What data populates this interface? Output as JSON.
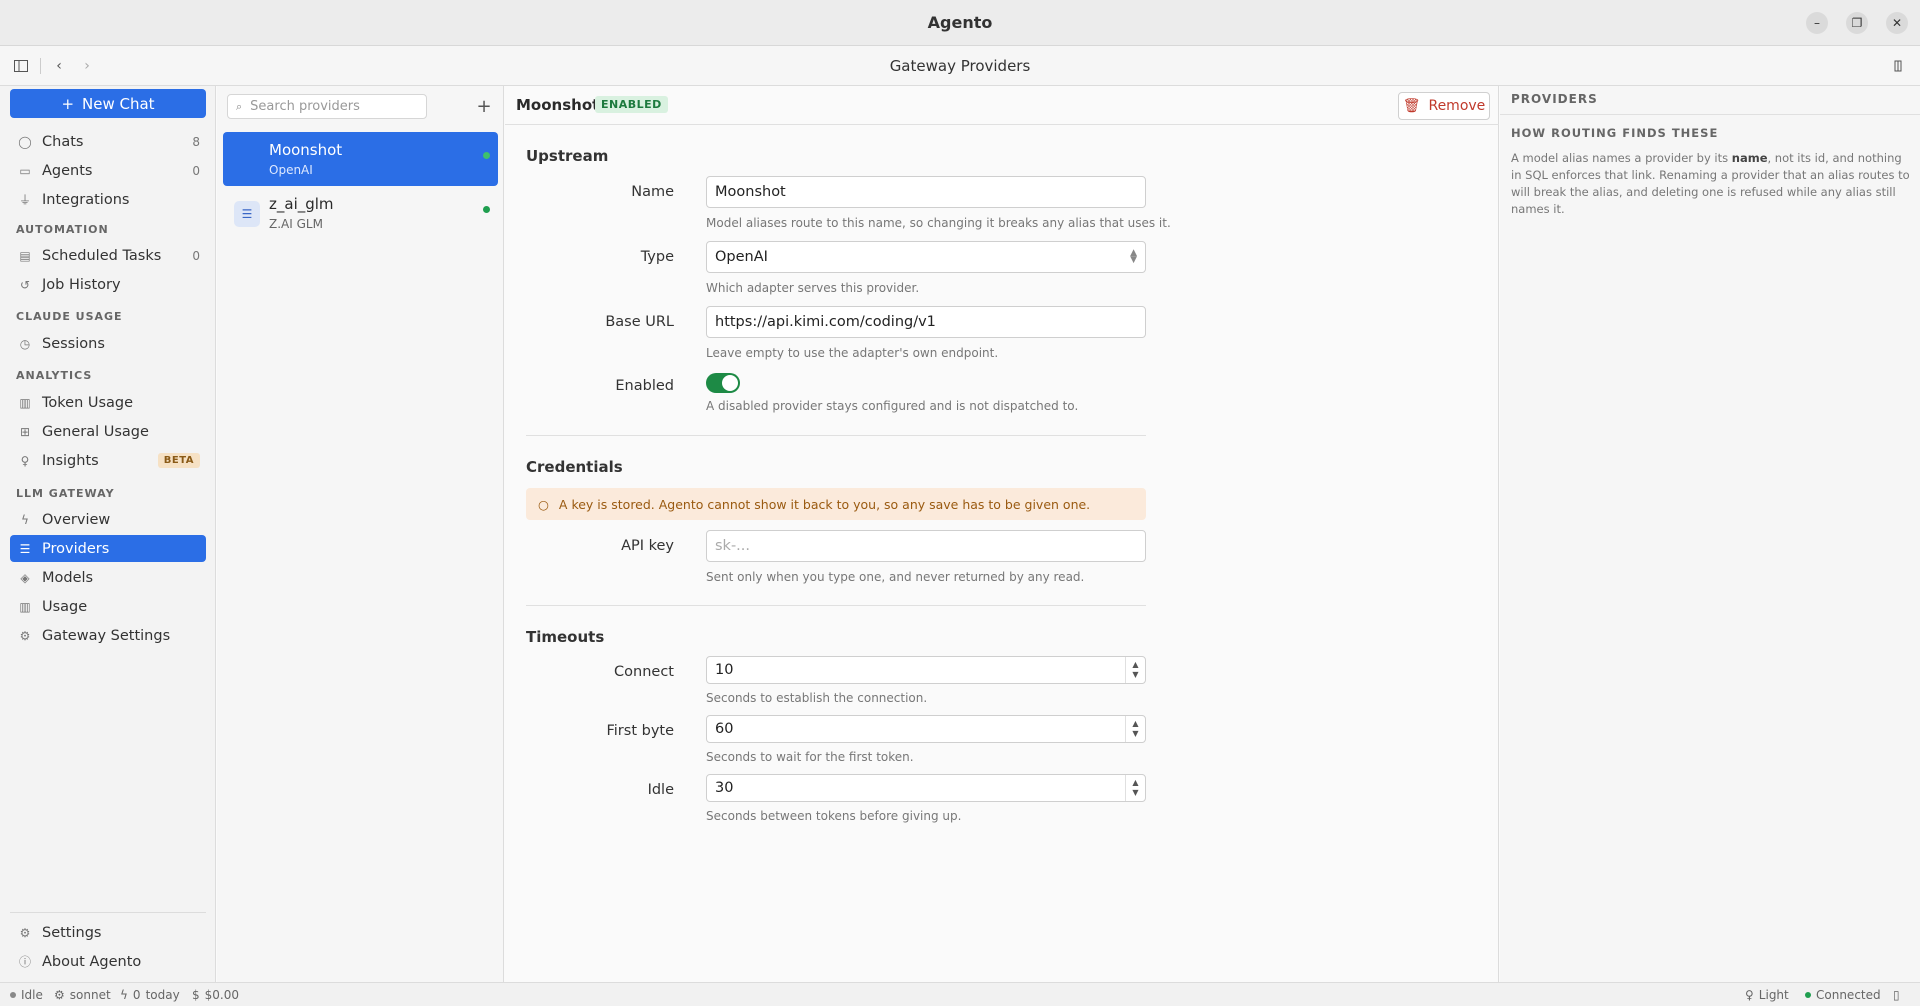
{
  "window": {
    "title": "Agento"
  },
  "toolbar": {
    "page_title": "Gateway Providers"
  },
  "sidebar": {
    "new_chat": "New Chat",
    "items": [
      {
        "label": "Chats",
        "count": "8",
        "icon": "chat-icon"
      },
      {
        "label": "Agents",
        "count": "0",
        "icon": "agents-icon"
      },
      {
        "label": "Integrations",
        "icon": "plug-icon"
      }
    ],
    "automation": {
      "heading": "AUTOMATION",
      "items": [
        {
          "label": "Scheduled Tasks",
          "count": "0",
          "icon": "calendar-icon"
        },
        {
          "label": "Job History",
          "icon": "history-icon"
        }
      ]
    },
    "claude_usage": {
      "heading": "CLAUDE USAGE",
      "items": [
        {
          "label": "Sessions",
          "icon": "clock-icon"
        }
      ]
    },
    "analytics": {
      "heading": "ANALYTICS",
      "items": [
        {
          "label": "Token Usage",
          "icon": "bar-chart-icon"
        },
        {
          "label": "General Usage",
          "icon": "grid-icon"
        },
        {
          "label": "Insights",
          "badge": "BETA",
          "icon": "lightbulb-icon"
        }
      ]
    },
    "gateway": {
      "heading": "LLM GATEWAY",
      "items": [
        {
          "label": "Overview",
          "icon": "bolt-icon"
        },
        {
          "label": "Providers",
          "icon": "database-icon",
          "active": true
        },
        {
          "label": "Models",
          "icon": "layers-icon"
        },
        {
          "label": "Usage",
          "icon": "bar-chart-icon"
        },
        {
          "label": "Gateway Settings",
          "icon": "gear-icon"
        }
      ]
    },
    "bottom": [
      {
        "label": "Settings",
        "icon": "gear-icon"
      },
      {
        "label": "About Agento",
        "icon": "info-icon"
      }
    ]
  },
  "providers": {
    "search_placeholder": "Search providers",
    "items": [
      {
        "name": "Moonshot",
        "type": "OpenAI",
        "active": true
      },
      {
        "name": "z_ai_glm",
        "type": "Z.AI GLM"
      }
    ]
  },
  "detail": {
    "title": "Moonshot",
    "status_badge": "ENABLED",
    "remove_label": "Remove",
    "upstream": {
      "heading": "Upstream",
      "name_label": "Name",
      "name_value": "Moonshot",
      "name_help": "Model aliases route to this name, so changing it breaks any alias that uses it.",
      "type_label": "Type",
      "type_value": "OpenAI",
      "type_help": "Which adapter serves this provider.",
      "url_label": "Base URL",
      "url_value": "https://api.kimi.com/coding/v1",
      "url_help": "Leave empty to use the adapter's own endpoint.",
      "enabled_label": "Enabled",
      "enabled_value": true,
      "enabled_help": "A disabled provider stays configured and is not dispatched to."
    },
    "credentials": {
      "heading": "Credentials",
      "alert": "A key is stored. Agento cannot show it back to you, so any save has to be given one.",
      "key_label": "API key",
      "key_placeholder": "sk-...",
      "key_help": "Sent only when you type one, and never returned by any read."
    },
    "timeouts": {
      "heading": "Timeouts",
      "connect_label": "Connect",
      "connect_value": "10",
      "connect_help": "Seconds to establish the connection.",
      "first_byte_label": "First byte",
      "first_byte_value": "60",
      "first_byte_help": "Seconds to wait for the first token.",
      "idle_label": "Idle",
      "idle_value": "30",
      "idle_help": "Seconds between tokens before giving up."
    }
  },
  "right_panel": {
    "heading": "PROVIDERS",
    "subheading": "HOW ROUTING FINDS THESE",
    "text_1": "A model alias names a provider by its ",
    "text_bold": "name",
    "text_2": ", not its id, and nothing in SQL enforces that link. Renaming a provider that an alias routes to will break the alias, and deleting one is refused while any alias still names it."
  },
  "status": {
    "state": "Idle",
    "model": "sonnet",
    "today_count": "0",
    "today_label": "today",
    "cost": "$0.00",
    "theme": "Light",
    "connection": "Connected"
  },
  "colors": {
    "accent": "#2b6ee6",
    "enabled_green": "#1d8a45",
    "danger": "#c0392b"
  }
}
